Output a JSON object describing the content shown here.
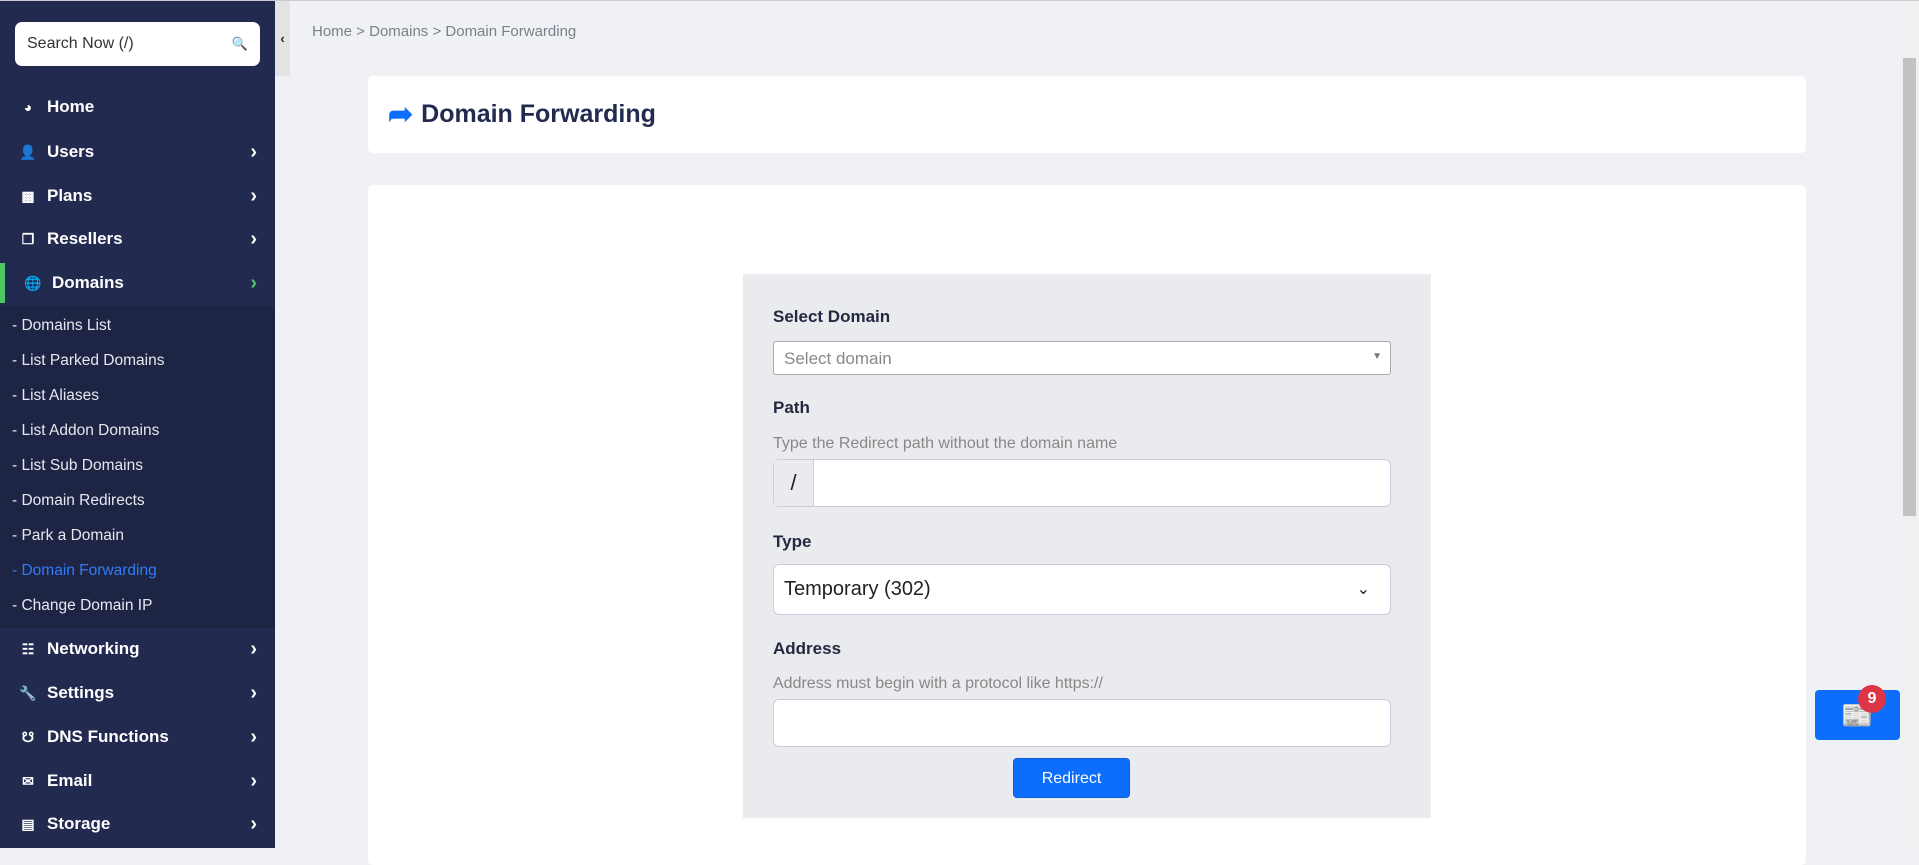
{
  "sidebar": {
    "search_placeholder": "Search Now (/)",
    "items": [
      {
        "label": "Home",
        "icon": "gauge-icon"
      },
      {
        "label": "Users",
        "icon": "user-icon"
      },
      {
        "label": "Plans",
        "icon": "book-icon"
      },
      {
        "label": "Resellers",
        "icon": "clone-icon"
      },
      {
        "label": "Domains",
        "icon": "globe-icon"
      },
      {
        "label": "Networking",
        "icon": "network-icon"
      },
      {
        "label": "Settings",
        "icon": "wrench-icon"
      },
      {
        "label": "DNS Functions",
        "icon": "sitemap-icon"
      },
      {
        "label": "Email",
        "icon": "envelope-icon"
      },
      {
        "label": "Storage",
        "icon": "hdd-icon"
      }
    ],
    "submenu": [
      "- Domains List",
      "- List Parked Domains",
      "- List Aliases",
      "- List Addon Domains",
      "- List Sub Domains",
      "- Domain Redirects",
      "- Park a Domain",
      "- Domain Forwarding",
      "- Change Domain IP"
    ],
    "accent": "#4cc764"
  },
  "breadcrumb": "Home > Domains > Domain Forwarding",
  "page_title": "Domain Forwarding",
  "form": {
    "select_domain_label": "Select Domain",
    "select_domain_placeholder": "Select domain",
    "path_label": "Path",
    "path_hint": "Type the Redirect path without the domain name",
    "path_prefix": "/",
    "path_value": "",
    "type_label": "Type",
    "type_value": "Temporary (302)",
    "address_label": "Address",
    "address_hint": "Address must begin with a protocol like https://",
    "address_value": "",
    "submit": "Redirect"
  },
  "notifications": {
    "count": "9"
  }
}
